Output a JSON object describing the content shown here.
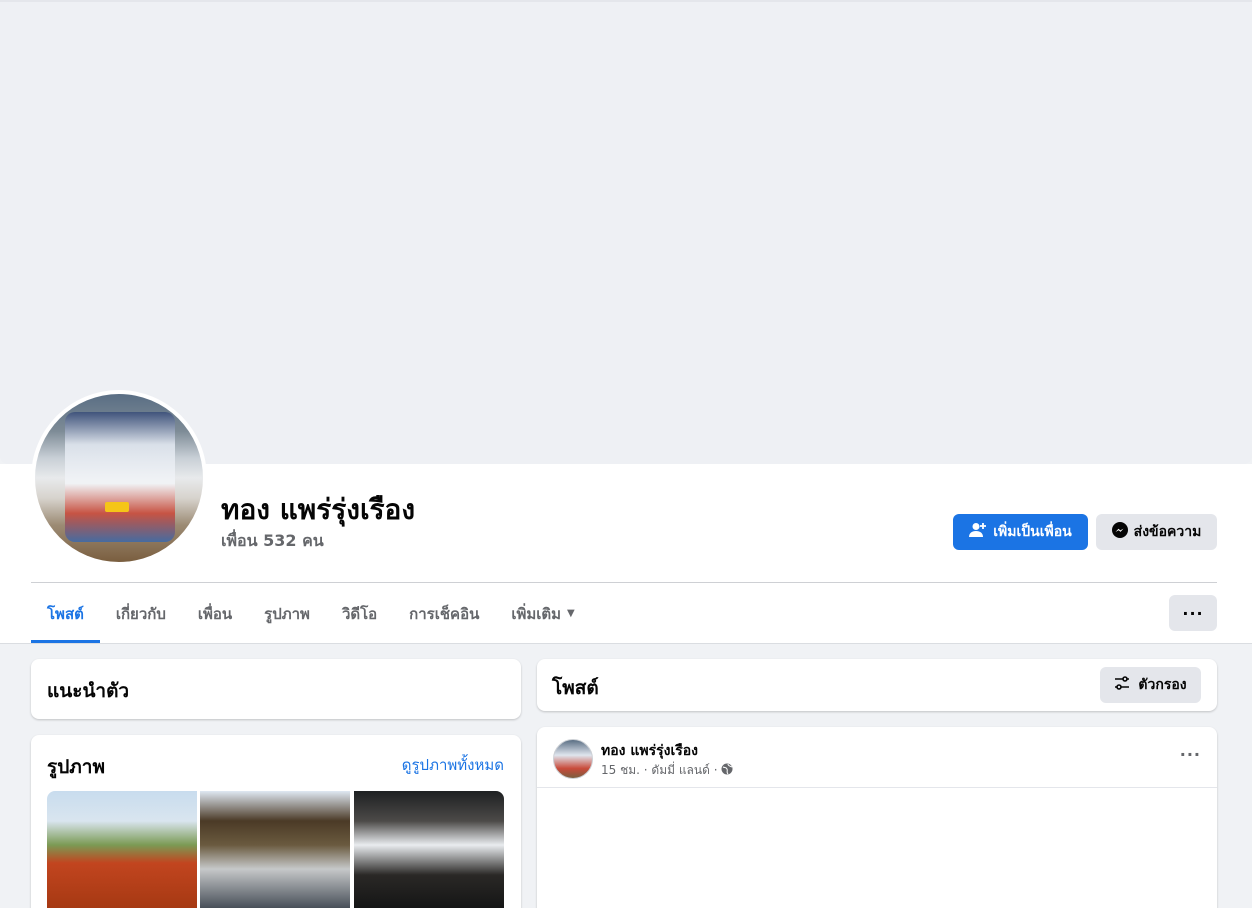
{
  "profile": {
    "name": "ทอง แพร่รุ่งเรือง",
    "friends_count": "เพื่อน 532 คน"
  },
  "actions": {
    "add_friend": "เพิ่มเป็นเพื่อน",
    "message": "ส่งข้อความ",
    "more": "···"
  },
  "tabs": [
    {
      "label": "โพสต์",
      "active": true
    },
    {
      "label": "เกี่ยวกับ",
      "active": false
    },
    {
      "label": "เพื่อน",
      "active": false
    },
    {
      "label": "รูปภาพ",
      "active": false
    },
    {
      "label": "วิดีโอ",
      "active": false
    },
    {
      "label": "การเช็คอิน",
      "active": false
    },
    {
      "label": "เพิ่มเติม",
      "active": false
    }
  ],
  "intro": {
    "title": "แนะนำตัว"
  },
  "photos": {
    "title": "รูปภาพ",
    "see_all": "ดูรูปภาพทั้งหมด"
  },
  "posts": {
    "title": "โพสต์",
    "filter_label": "ตัวกรอง",
    "first_post": {
      "author": "ทอง แพร่รุ่งเรือง",
      "meta": "15 ชม. · ดัมมี่ แลนด์ ·",
      "more": "···"
    }
  },
  "colors": {
    "accent": "#1b74e4",
    "page_bg": "#f0f2f5",
    "secondary_text": "#65676b"
  },
  "icons": [
    "add-friend-icon",
    "messenger-icon",
    "caret-down-icon",
    "filter-icon",
    "globe-icon",
    "more-dots-icon"
  ]
}
